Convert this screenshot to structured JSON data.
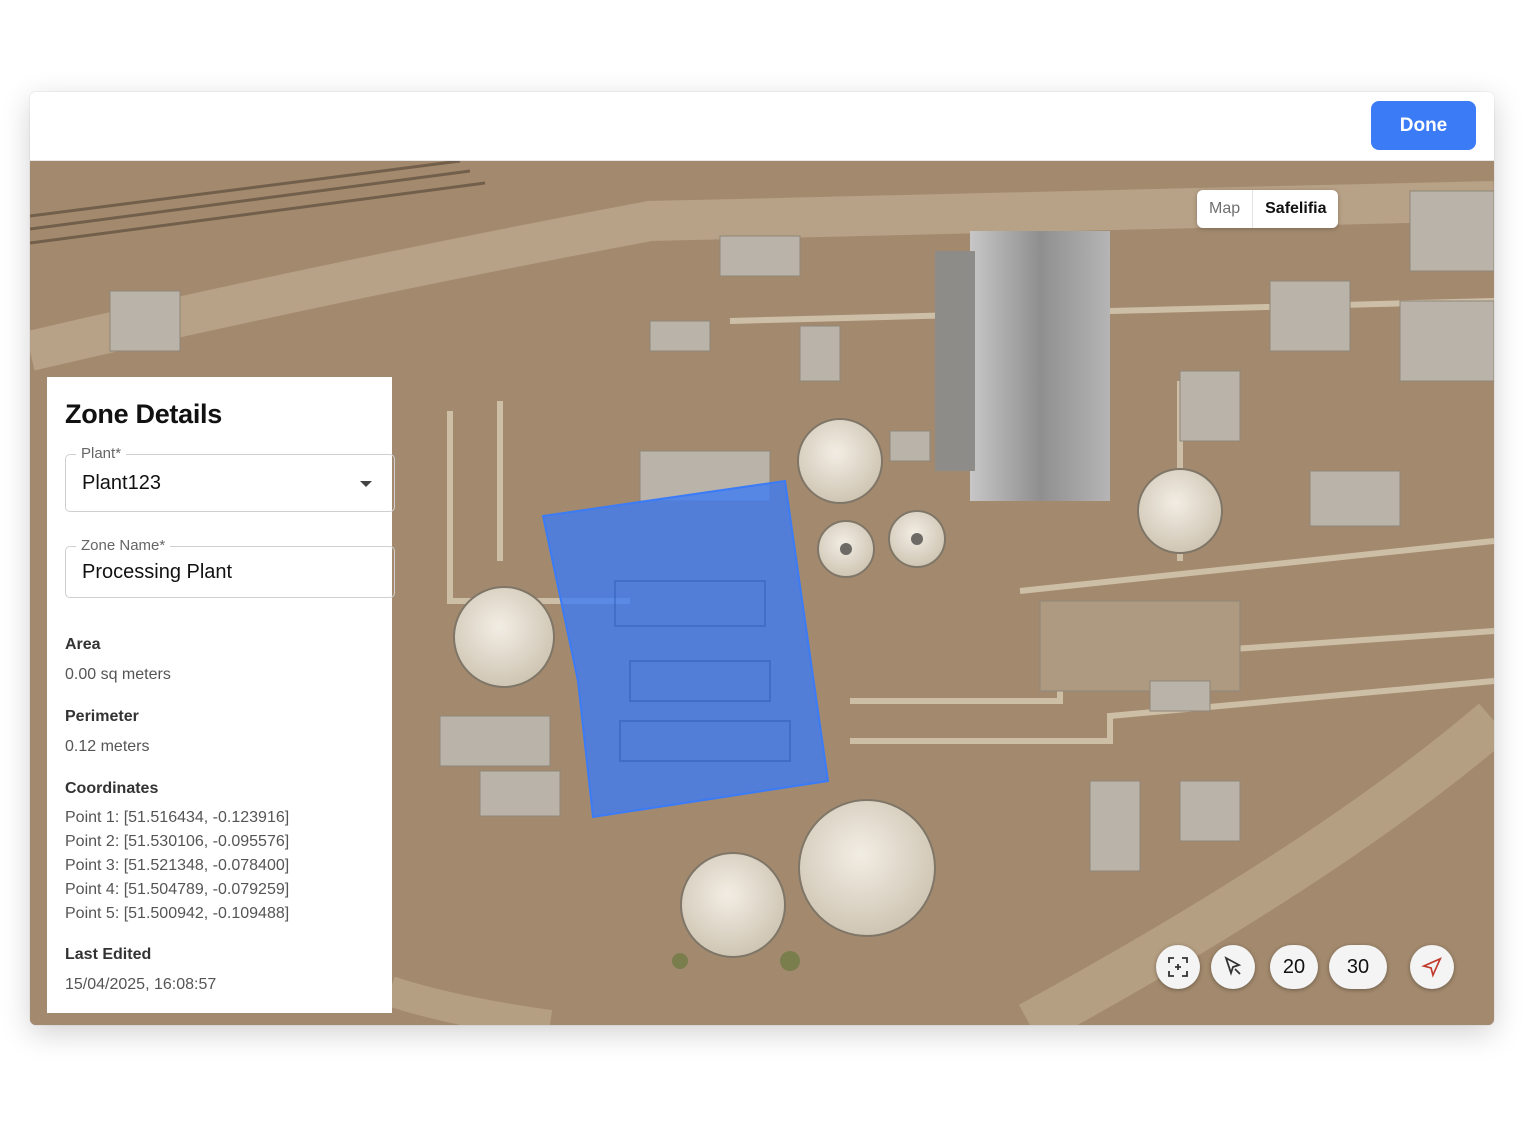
{
  "toolbar": {
    "done_label": "Done"
  },
  "map": {
    "type_options": {
      "map": "Map",
      "satellite": "Safelifia"
    },
    "zone_color": "#3b7bf6",
    "controls": {
      "fit_icon": "fit-bounds-icon",
      "select_icon": "pointer-cursor-icon",
      "zoom_a": "20",
      "zoom_b": "30",
      "locate_icon": "navigation-arrow-icon"
    }
  },
  "panel": {
    "title": "Zone Details",
    "plant": {
      "label": "Plant*",
      "value": "Plant123"
    },
    "zone_name": {
      "label": "Zone Name*",
      "value": "Processing Plant"
    },
    "area": {
      "label": "Area",
      "value": "0.00 sq meters"
    },
    "perimeter": {
      "label": "Perimeter",
      "value": "0.12 meters"
    },
    "coordinates": {
      "label": "Coordinates",
      "points": [
        "Point 1: [51.516434, -0.123916]",
        "Point 2: [51.530106, -0.095576]",
        "Point 3: [51.521348, -0.078400]",
        "Point 4: [51.504789, -0.079259]",
        "Point 5: [51.500942, -0.109488]"
      ]
    },
    "last_edited": {
      "label": "Last Edited",
      "value": "15/04/2025, 16:08:57"
    }
  }
}
